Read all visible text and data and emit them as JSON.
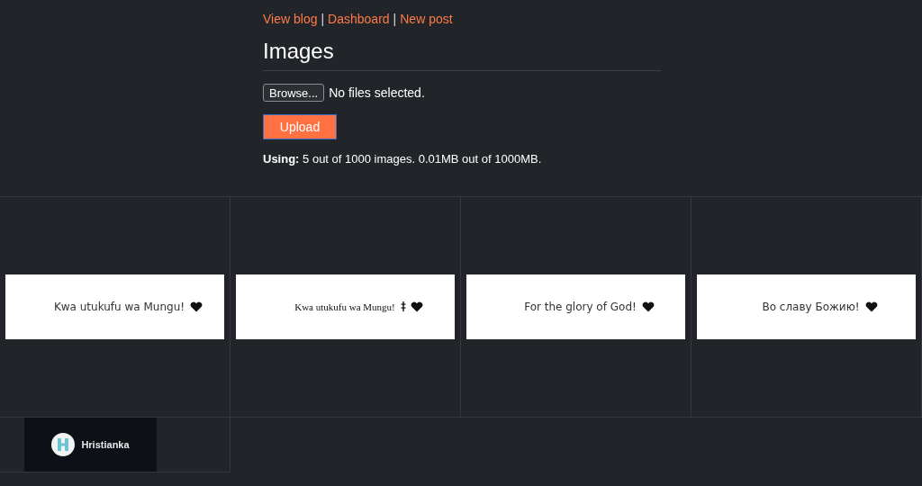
{
  "nav_links": [
    {
      "label": "View blog"
    },
    {
      "label": "Dashboard"
    },
    {
      "label": "New post"
    }
  ],
  "nav_separator": "|",
  "heading": "Images",
  "file_picker": {
    "button": "Browse...",
    "status": "No files selected."
  },
  "upload_button": "Upload",
  "usage": "**Using:** 5 out of 1000 images. 0.01MB out of 1000MB.",
  "images": [
    {
      "kind": "banner",
      "text": "Kwa utukufu wa Mungu!"
    },
    {
      "kind": "banner-serif",
      "text": "Kwa utukufu wa Mungu!"
    },
    {
      "kind": "banner",
      "text": "For the glory of God!"
    },
    {
      "kind": "banner",
      "text": "Во славу Божию!"
    },
    {
      "kind": "logo",
      "text": "Hristianka"
    }
  ]
}
